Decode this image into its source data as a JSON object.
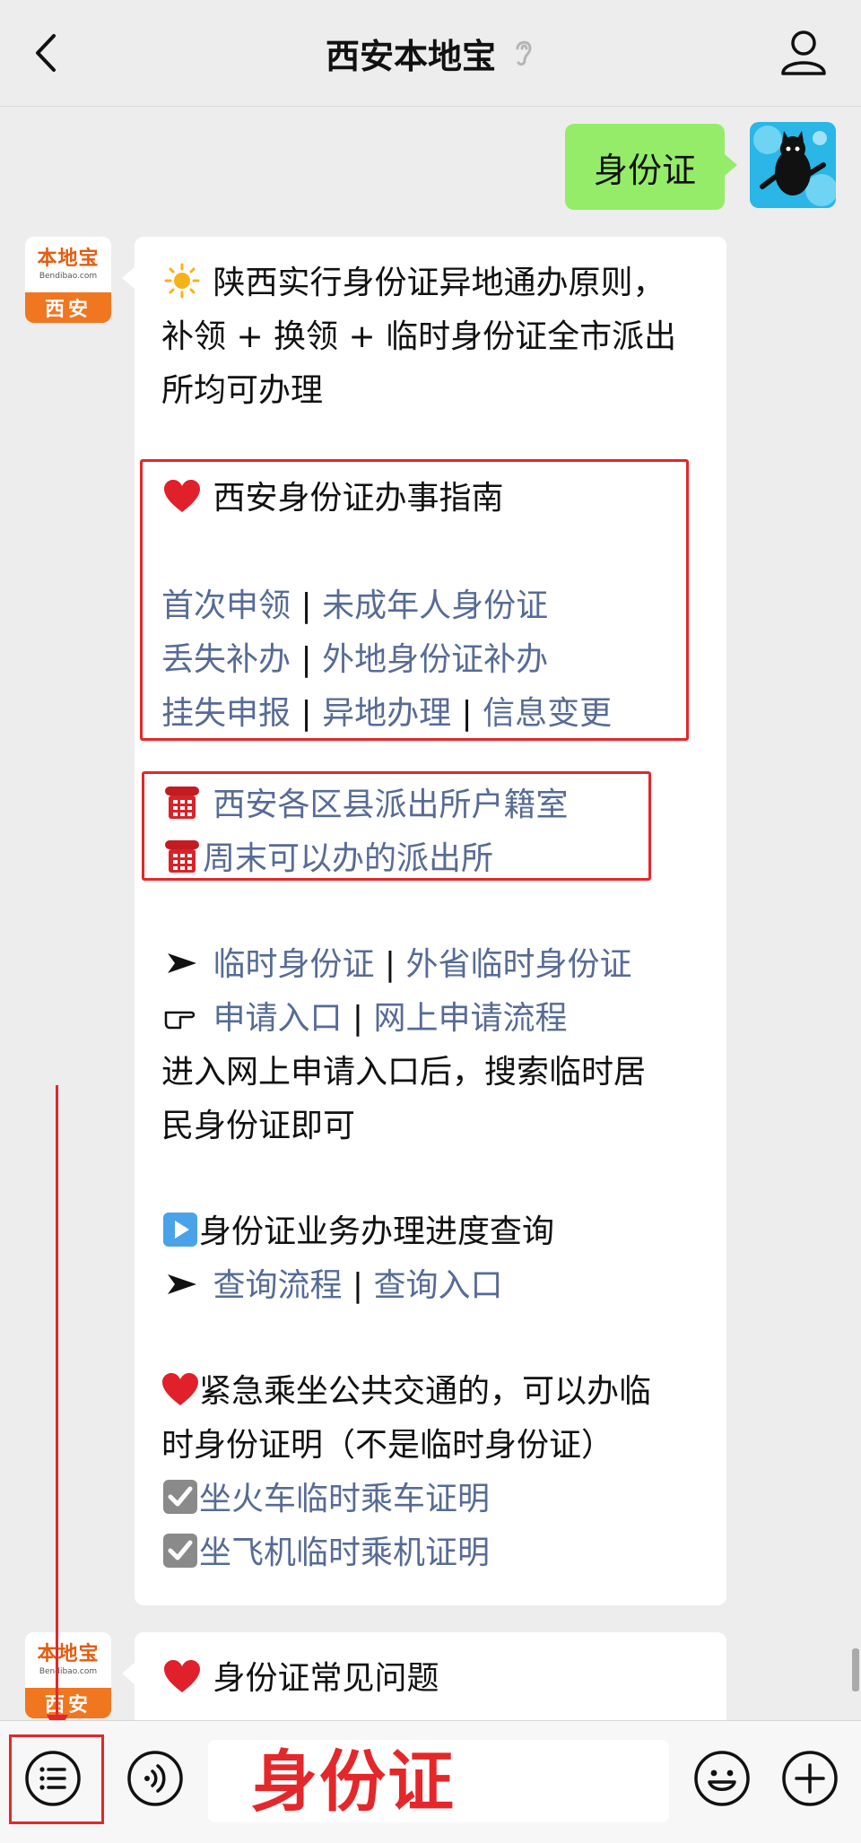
{
  "header": {
    "title": "西安本地宝"
  },
  "user_message": {
    "text": "身份证"
  },
  "bot_avatar": {
    "main": "本地宝",
    "sub": "Bendibao.com",
    "city": "西安"
  },
  "message1": {
    "intro_lines": [
      "陕西实行身份证异地通办原则，",
      "补领 + 换领 + 临时身份证全市派出",
      "所均可办理"
    ],
    "guide_title": "西安身份证办事指南",
    "guide_rows": [
      [
        "首次申领",
        "未成年人身份证"
      ],
      [
        "丢失补办",
        "外地身份证补办"
      ],
      [
        "挂失申报",
        "异地办理",
        "信息变更"
      ]
    ],
    "phone_links": [
      "西安各区县派出所户籍室",
      "周末可以办的派出所"
    ],
    "temp_links": [
      "临时身份证",
      "外省临时身份证"
    ],
    "apply_links": [
      "申请入口",
      "网上申请流程"
    ],
    "apply_note": [
      "进入网上申请入口后，搜索临时居",
      "民身份证即可"
    ],
    "progress_title": "身份证业务办理进度查询",
    "progress_links": [
      "查询流程",
      "查询入口"
    ],
    "emergency_lines": [
      "紧急乘坐公共交通的，可以办临",
      "时身份证明（不是临时身份证）"
    ],
    "check_links": [
      "坐火车临时乘车证明",
      "坐飞机临时乘机证明"
    ]
  },
  "message2": {
    "title": "身份证常见问题"
  },
  "separator": "|",
  "input": {
    "text": "身份证"
  }
}
